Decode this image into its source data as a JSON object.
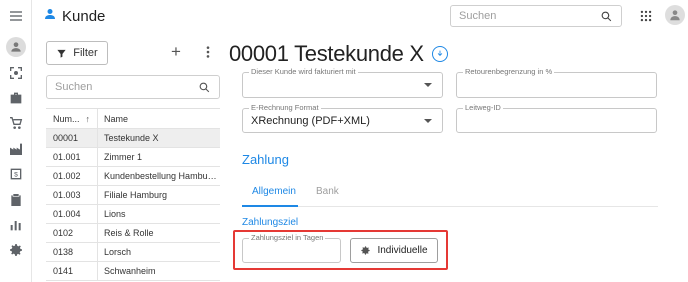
{
  "header": {
    "title": "Kunde",
    "search_placeholder": "Suchen"
  },
  "rail": {
    "items": [
      "menu-icon",
      "person-icon",
      "scan-icon",
      "briefcase-icon",
      "cart-icon",
      "factory-icon",
      "invoice-icon",
      "clipboard-icon",
      "chart-icon",
      "settings-icon"
    ]
  },
  "list": {
    "filter_label": "Filter",
    "search_placeholder": "Suchen",
    "columns": [
      "Num...",
      "Name"
    ],
    "rows": [
      {
        "num": "00001",
        "name": "Testekunde X",
        "selected": true
      },
      {
        "num": "01.001",
        "name": "Zimmer 1"
      },
      {
        "num": "01.002",
        "name": "Kundenbestellung Hambu…"
      },
      {
        "num": "01.003",
        "name": "Filiale Hamburg"
      },
      {
        "num": "01.004",
        "name": "Lions"
      },
      {
        "num": "0102",
        "name": "Reis & Rolle"
      },
      {
        "num": "0138",
        "name": "Lorsch"
      },
      {
        "num": "0141",
        "name": "Schwanheim"
      }
    ]
  },
  "detail": {
    "title": "00001 Testekunde X",
    "fields": {
      "billing_label": "Dieser Kunde wird fakturiert mit",
      "billing_value": "",
      "return_limit_label": "Retourenbegrenzung in %",
      "return_limit_value": "",
      "einvoice_label": "E-Rechnung Format",
      "einvoice_value": "XRechnung (PDF+XML)",
      "leitweg_label": "Leitweg-ID",
      "leitweg_value": ""
    },
    "section_title": "Zahlung",
    "tabs": [
      "Allgemein",
      "Bank"
    ],
    "subsection_title": "Zahlungsziel",
    "days_label": "Zahlungsziel in Tagen",
    "days_value": "",
    "individual_button": "Individuelle"
  },
  "colors": {
    "accent": "#1e88e5",
    "highlight": "#e53935"
  }
}
